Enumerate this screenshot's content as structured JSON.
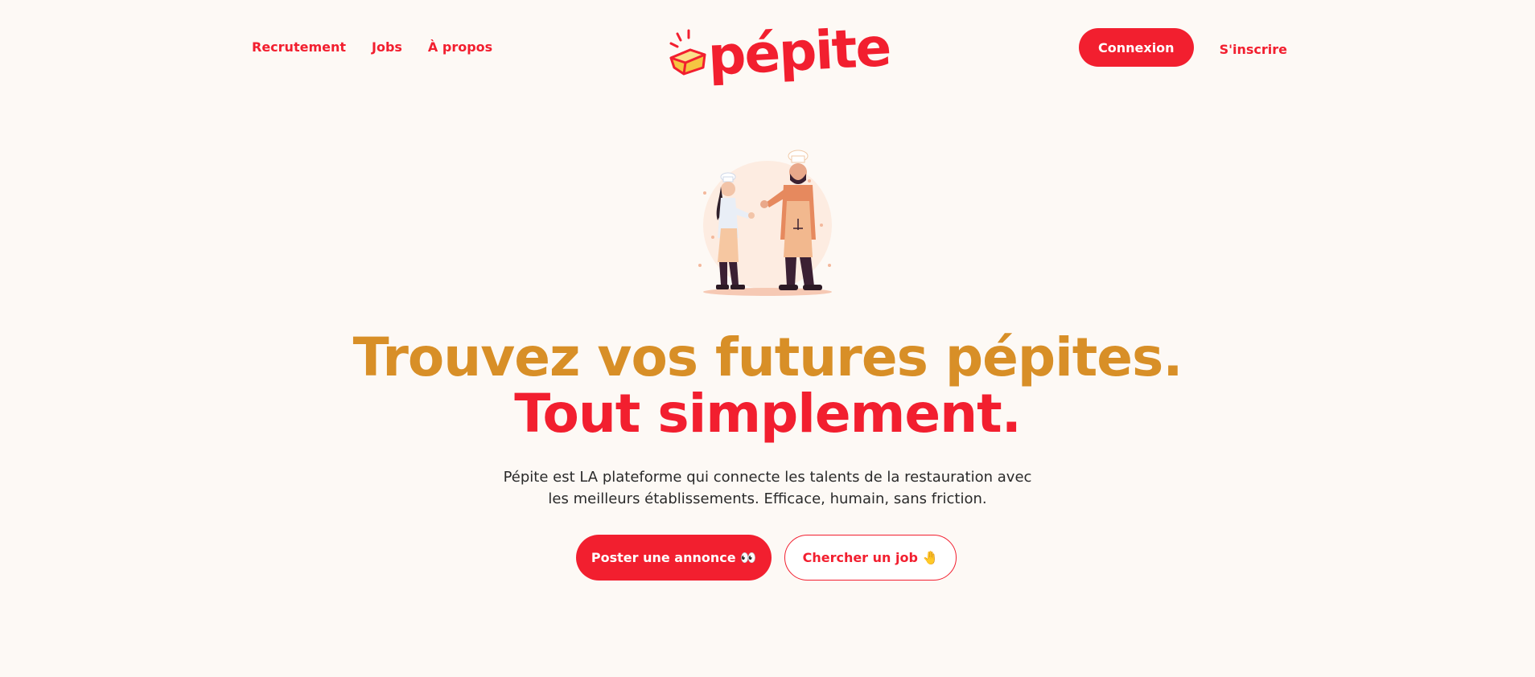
{
  "header": {
    "nav_left": [
      {
        "label": "Recrutement"
      },
      {
        "label": "Jobs"
      },
      {
        "label": "À propos"
      }
    ],
    "logo_text": "pépite",
    "login_label": "Connexion",
    "signup_label": "S'inscrire"
  },
  "hero": {
    "illustration": "chefs-illustration",
    "headline_line1": "Trouvez vos futures pépites.",
    "headline_line2": "Tout simplement.",
    "subtitle_line1": "Pépite est LA plateforme qui connecte les talents de la restauration avec",
    "subtitle_line2": "les meilleurs établissements. Efficace, humain, sans friction.",
    "cta_primary": "Poster une annonce 👀",
    "cta_secondary": "Chercher un job 🤚"
  },
  "colors": {
    "brand_red": "#f21f2f",
    "gold": "#d88f27",
    "background": "#fdf9f5",
    "text": "#2a2a2a"
  }
}
